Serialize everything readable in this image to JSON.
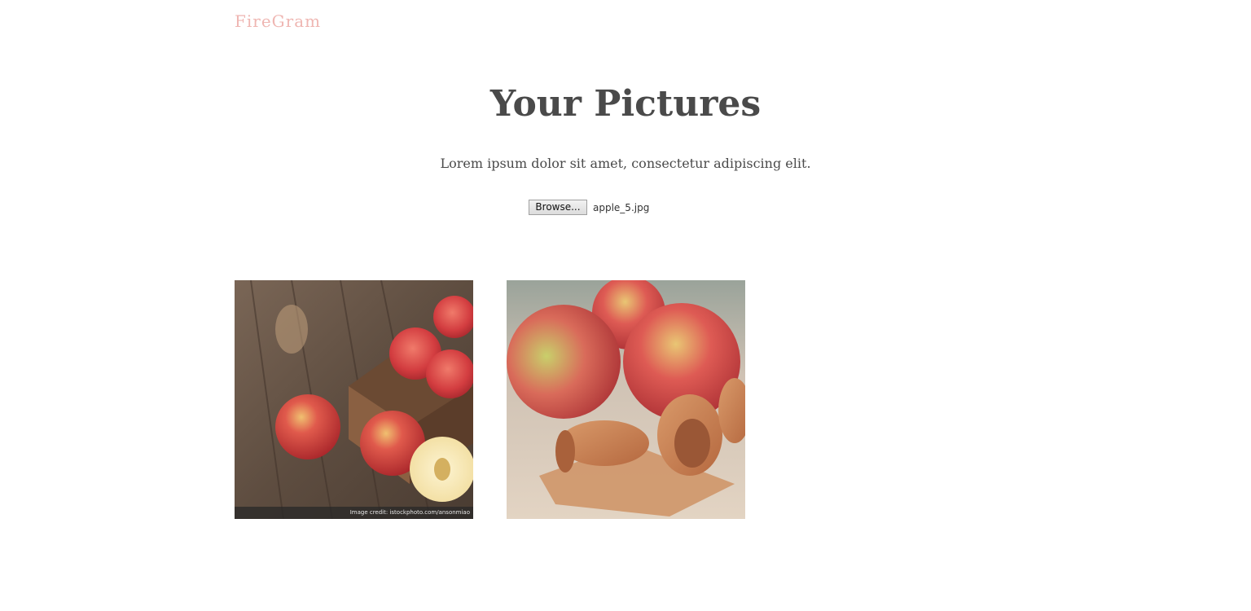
{
  "header": {
    "logo": "FireGram"
  },
  "main": {
    "title": "Your Pictures",
    "subtitle": "Lorem ipsum dolor sit amet, consectetur adipiscing elit."
  },
  "upload": {
    "button_label": "Browse...",
    "file_name": "apple_5.jpg"
  },
  "gallery": {
    "images": [
      {
        "subject": "apples on wooden table with crate",
        "credit": "Image credit: istockphoto.com/ansonmiao"
      },
      {
        "subject": "apples with rolled fruit leather",
        "credit": ""
      }
    ]
  },
  "colors": {
    "logo": "#efb6b2",
    "text": "#4a4a4a",
    "background": "#ffffff"
  }
}
